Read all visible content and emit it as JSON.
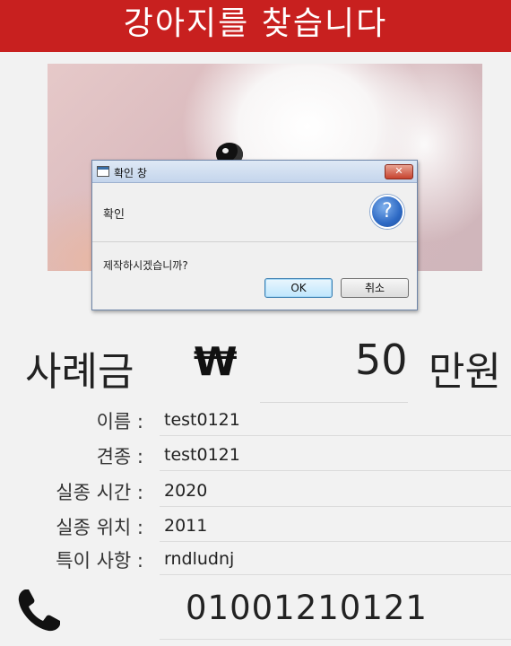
{
  "header": {
    "title": "강아지를 찾습니다"
  },
  "dialog": {
    "title": "확인 창",
    "close_label": "✕",
    "header_text": "확인",
    "content": "제작하시겠습니까?",
    "ok_label": "OK",
    "cancel_label": "취소"
  },
  "reward": {
    "label": "사례금",
    "currency": "₩",
    "amount": "50",
    "unit": "만원"
  },
  "fields": [
    {
      "label": "이름 :",
      "value": "test0121"
    },
    {
      "label": "견종 :",
      "value": "test0121"
    },
    {
      "label": "실종 시간 :",
      "value": "2020"
    },
    {
      "label": "실종 위치 :",
      "value": "2011"
    },
    {
      "label": "특이 사항 :",
      "value": "rndludnj"
    }
  ],
  "contact": {
    "phone": "01001210121"
  },
  "colors": {
    "header_bg": "#c8201f",
    "page_bg": "#f2f2f2"
  }
}
